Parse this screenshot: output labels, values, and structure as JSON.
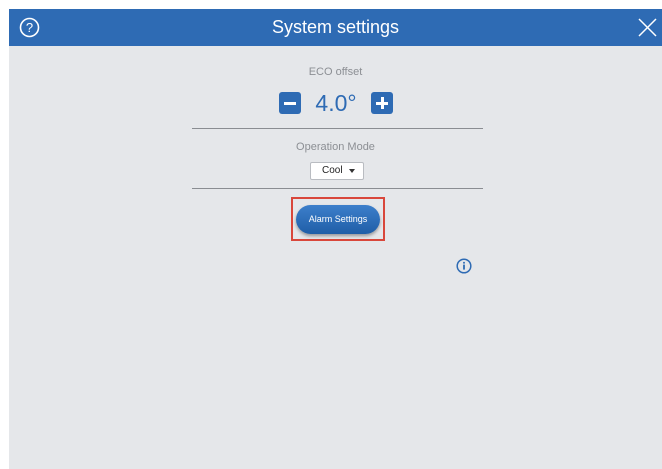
{
  "header": {
    "title": "System settings",
    "help_icon": "help-circle-icon",
    "close_icon": "close-icon",
    "color": "#2e6bb4"
  },
  "eco_offset": {
    "label": "ECO offset",
    "value": "4.0°",
    "decrease_icon": "minus-icon",
    "increase_icon": "plus-icon"
  },
  "operation_mode": {
    "label": "Operation Mode",
    "selected": "Cool"
  },
  "alarm": {
    "button_label": "Alarm Settings",
    "highlight_color": "#d9473b"
  },
  "info_icon": "info-icon"
}
